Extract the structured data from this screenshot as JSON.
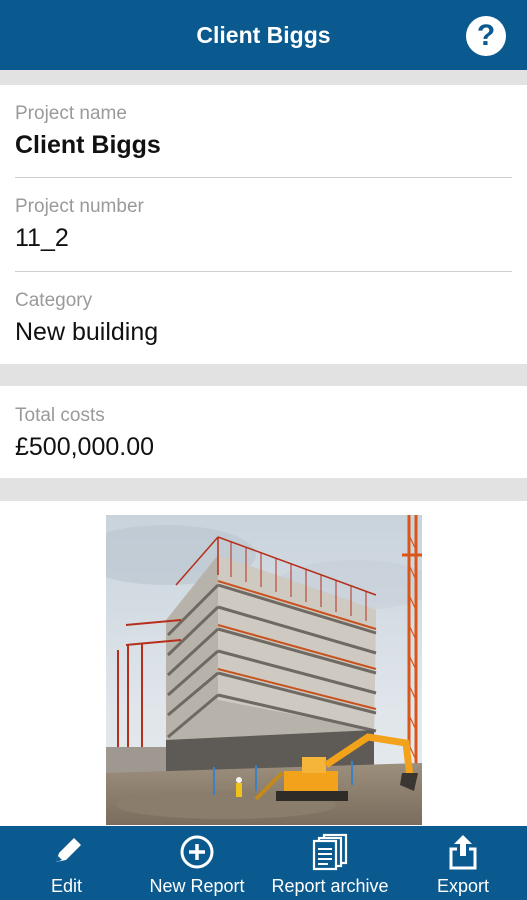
{
  "header": {
    "title": "Client Biggs",
    "help_icon": "question-mark-icon"
  },
  "project": {
    "name_label": "Project name",
    "name_value": "Client Biggs",
    "number_label": "Project number",
    "number_value": "11_2",
    "category_label": "Category",
    "category_value": "New building"
  },
  "costs": {
    "label": "Total costs",
    "value": "£500,000.00"
  },
  "photo": {
    "subject": "construction-site-photo"
  },
  "bottom_nav": {
    "edit": "Edit",
    "new_report": "New Report",
    "report_archive": "Report archive",
    "export": "Export"
  },
  "colors": {
    "primary": "#0a5a8f",
    "background": "#e2e2e2",
    "label": "#9a9a9a"
  }
}
